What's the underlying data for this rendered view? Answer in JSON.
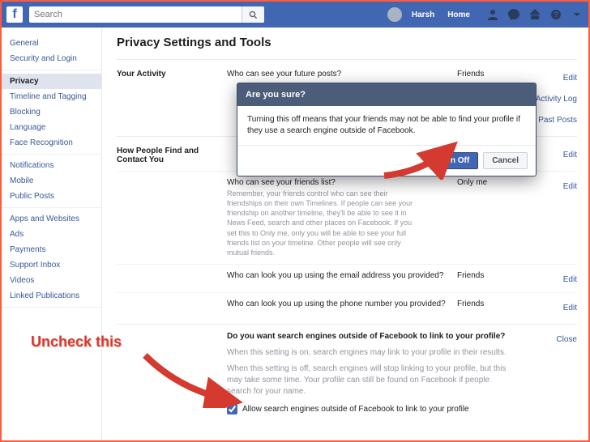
{
  "header": {
    "search_placeholder": "Search",
    "user_name": "Harsh",
    "home": "Home"
  },
  "sidebar_groups": [
    [
      "General",
      "Security and Login"
    ],
    [
      "Privacy",
      "Timeline and Tagging",
      "Blocking",
      "Language",
      "Face Recognition"
    ],
    [
      "Notifications",
      "Mobile",
      "Public Posts"
    ],
    [
      "Apps and Websites",
      "Ads",
      "Payments",
      "Support Inbox",
      "Videos",
      "Linked Publications"
    ]
  ],
  "active_sidebar": "Privacy",
  "page_title": "Privacy Settings and Tools",
  "activity": {
    "label": "Your Activity",
    "row1_setting": "Who can see your future posts?",
    "row1_value": "Friends",
    "row1_action": "Edit",
    "row2_action": "Use Activity Log",
    "row3_action": "Limit Past Posts"
  },
  "contact": {
    "label": "How People Find and Contact You",
    "rows": [
      {
        "setting": "",
        "value": "",
        "action": "Edit"
      },
      {
        "setting": "Who can see your friends list?",
        "desc": "Remember, your friends control who can see their friendships on their own Timelines. If people can see your friendship on another timeline, they'll be able to see it in News Feed, search and other places on Facebook. If you set this to Only me, only you will be able to see your full friends list on your timeline. Other people will see only mutual friends.",
        "value": "Only me",
        "action": "Edit"
      },
      {
        "setting": "Who can look you up using the email address you provided?",
        "value": "Friends",
        "action": "Edit"
      },
      {
        "setting": "Who can look you up using the phone number you provided?",
        "value": "Friends",
        "action": "Edit"
      }
    ],
    "search_engines": {
      "question": "Do you want search engines outside of Facebook to link to your profile?",
      "on_text": "When this setting is on, search engines may link to your profile in their results.",
      "off_text": "When this setting is off, search engines will stop linking to your profile, but this may take some time. Your profile can still be found on Facebook if people search for your name.",
      "checkbox_label": "Allow search engines outside of Facebook to link to your profile",
      "close": "Close"
    }
  },
  "modal": {
    "title": "Are you sure?",
    "body": "Turning this off means that your friends may not be able to find your profile if they use a search engine outside of Facebook.",
    "confirm": "Turn Off",
    "cancel": "Cancel"
  },
  "annotation": "Uncheck this"
}
